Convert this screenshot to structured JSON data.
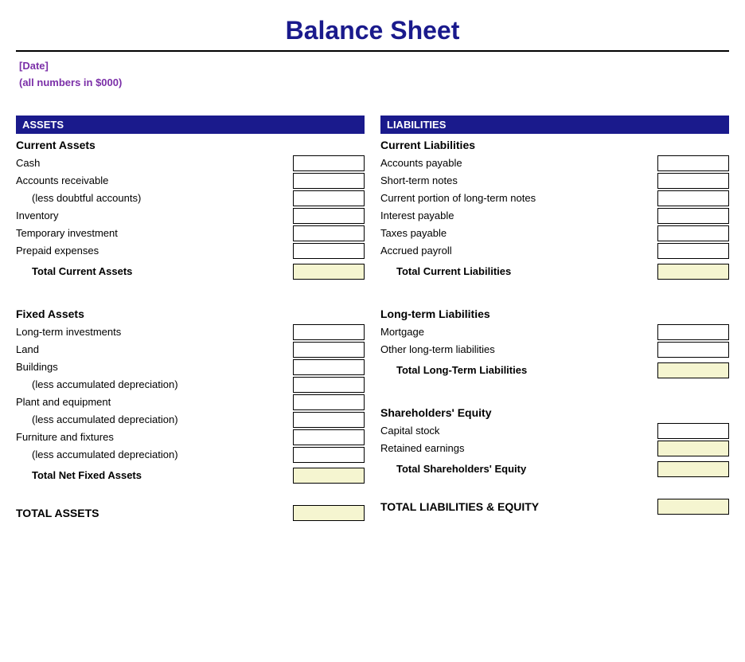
{
  "title": "Balance Sheet",
  "date_label": "[Date]",
  "numbers_note": "(all numbers in $000)",
  "assets": {
    "header": "ASSETS",
    "current_assets_title": "Current Assets",
    "current_items": [
      {
        "label": "Cash",
        "indented": false
      },
      {
        "label": "Accounts receivable",
        "indented": false
      },
      {
        "label": "(less doubtful accounts)",
        "indented": true
      },
      {
        "label": "Inventory",
        "indented": false
      },
      {
        "label": "Temporary investment",
        "indented": false
      },
      {
        "label": "Prepaid expenses",
        "indented": false
      }
    ],
    "total_current": "Total Current Assets",
    "fixed_assets_title": "Fixed Assets",
    "fixed_items": [
      {
        "label": "Long-term investments",
        "indented": false
      },
      {
        "label": "Land",
        "indented": false
      },
      {
        "label": "Buildings",
        "indented": false
      },
      {
        "label": "(less accumulated depreciation)",
        "indented": true
      },
      {
        "label": "Plant and equipment",
        "indented": false
      },
      {
        "label": "(less accumulated depreciation)",
        "indented": true
      },
      {
        "label": "Furniture and fixtures",
        "indented": false
      },
      {
        "label": "(less accumulated depreciation)",
        "indented": true
      }
    ],
    "total_fixed": "Total Net Fixed Assets",
    "grand_total": "TOTAL ASSETS"
  },
  "liabilities": {
    "header": "LIABILITIES",
    "current_liabilities_title": "Current Liabilities",
    "current_items": [
      {
        "label": "Accounts payable",
        "indented": false
      },
      {
        "label": "Short-term notes",
        "indented": false
      },
      {
        "label": "Current portion of long-term notes",
        "indented": false
      },
      {
        "label": "Interest payable",
        "indented": false
      },
      {
        "label": "Taxes payable",
        "indented": false
      },
      {
        "label": "Accrued payroll",
        "indented": false
      }
    ],
    "total_current": "Total Current Liabilities",
    "longterm_title": "Long-term Liabilities",
    "longterm_items": [
      {
        "label": "Mortgage",
        "indented": false
      },
      {
        "label": "Other long-term liabilities",
        "indented": false
      }
    ],
    "total_longterm": "Total Long-Term Liabilities",
    "equity_title": "Shareholders' Equity",
    "equity_items": [
      {
        "label": "Capital stock",
        "indented": false
      },
      {
        "label": "Retained earnings",
        "indented": false
      }
    ],
    "total_equity": "Total Shareholders' Equity",
    "grand_total": "TOTAL LIABILITIES & EQUITY"
  }
}
